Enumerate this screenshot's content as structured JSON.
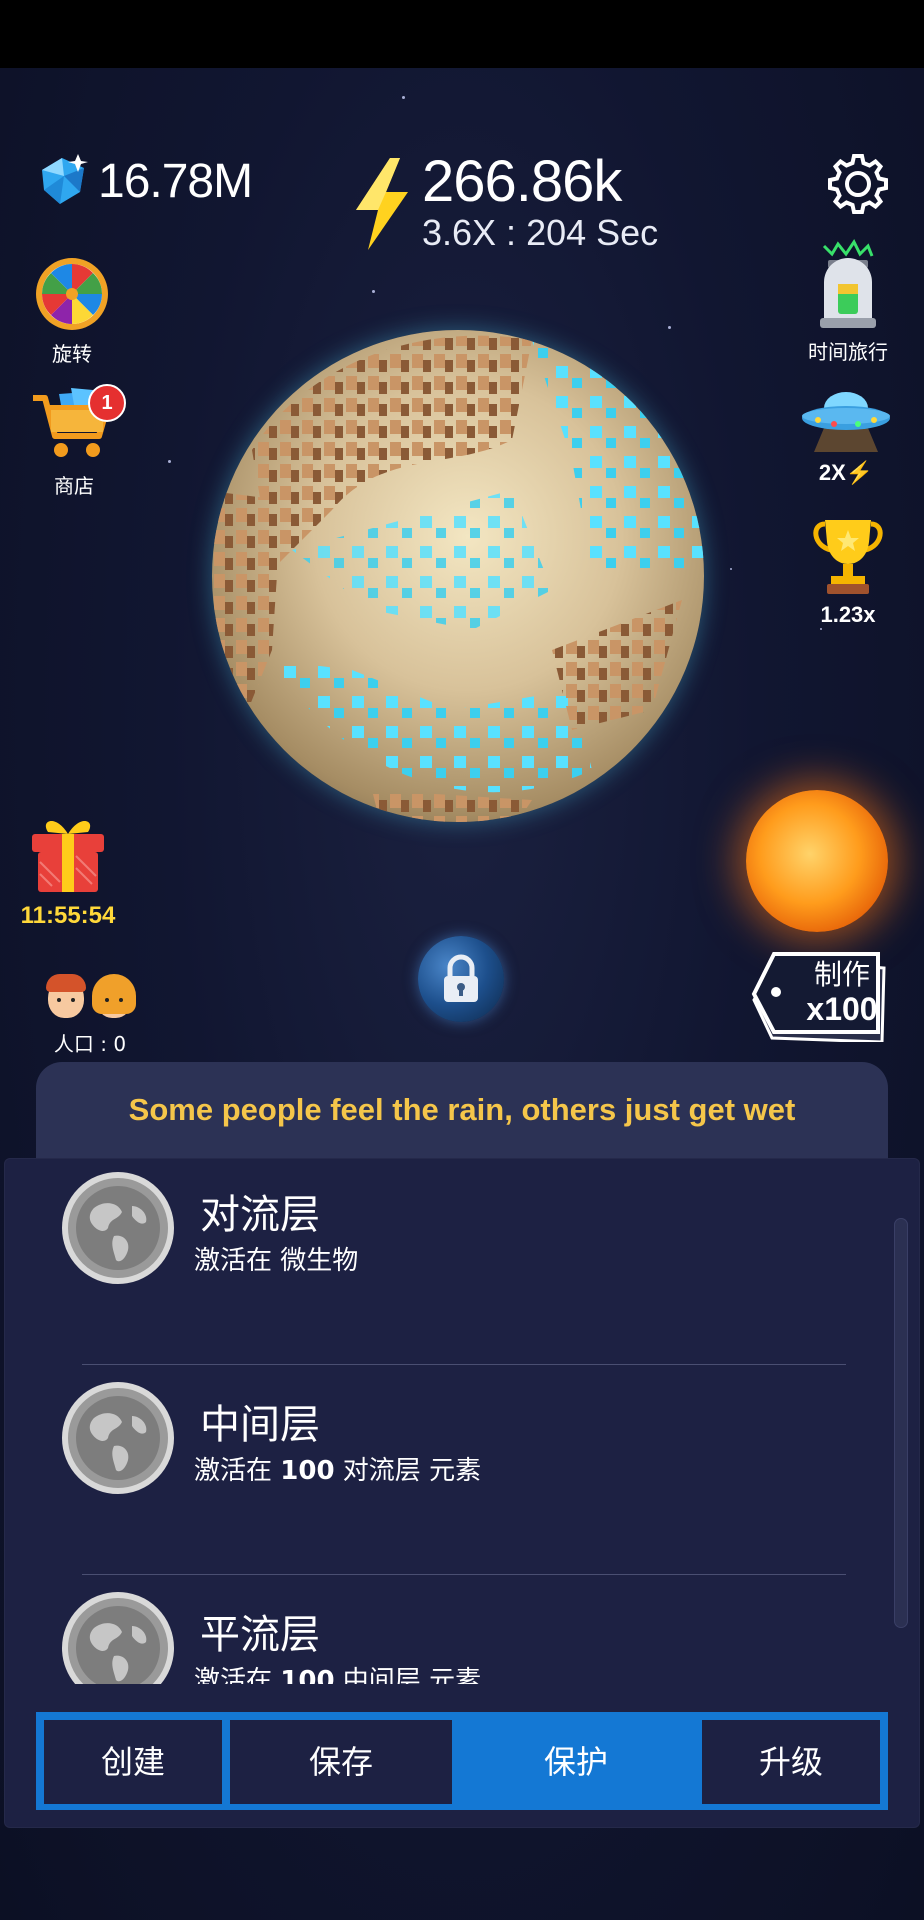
{
  "hud": {
    "gems": "16.78M",
    "energy": "266.86k",
    "energy_rate": "3.6X : 204 Sec"
  },
  "left_menu": {
    "spin_label": "旋转",
    "shop_label": "商店",
    "shop_badge": "1",
    "gift_timer": "11:55:54"
  },
  "right_menu": {
    "time_travel_label": "时间旅行",
    "ufo_multiplier": "2X",
    "trophy_multiplier": "1.23x"
  },
  "craft": {
    "label": "制作",
    "count": "x100"
  },
  "population": {
    "label": "人口 : 0"
  },
  "quote": "Some people feel the rain, others just get wet",
  "layers": [
    {
      "title": "对流层",
      "subtitle": "激活在 微生物"
    },
    {
      "title": "中间层",
      "subtitle_prefix": "激活在 ",
      "subtitle_number": "100",
      "subtitle_suffix": " 对流层 元素"
    },
    {
      "title": "平流层",
      "subtitle_prefix": "激活在 ",
      "subtitle_number": "100",
      "subtitle_suffix": " 中间层 元素"
    }
  ],
  "tabs": [
    {
      "label": "创建",
      "active": false
    },
    {
      "label": "保存",
      "active": false
    },
    {
      "label": "保护",
      "active": true
    },
    {
      "label": "升级",
      "active": false
    }
  ],
  "colors": {
    "accent_blue": "#1478d4",
    "quote_yellow": "#f5c64a",
    "panel_bg": "#1d2143",
    "timer_yellow": "#ffd83a"
  },
  "icons": [
    "gem-icon",
    "lightning-icon",
    "gear-icon",
    "prize-wheel-icon",
    "shopping-cart-icon",
    "gift-box-icon",
    "time-machine-icon",
    "ufo-icon",
    "trophy-icon",
    "sun-icon",
    "lock-icon",
    "price-tag-icon",
    "globe-icon"
  ]
}
